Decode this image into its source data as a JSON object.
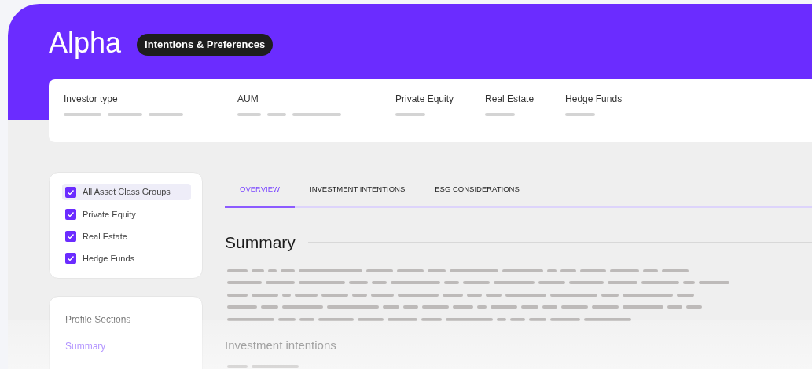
{
  "header": {
    "title": "Alpha",
    "badge": "Intentions & Preferences"
  },
  "info_groups": [
    [
      {
        "label": "Investor type"
      }
    ],
    [
      {
        "label": "AUM"
      }
    ],
    [
      {
        "label": "Private Equity"
      },
      {
        "label": "Real Estate"
      },
      {
        "label": "Hedge Funds"
      }
    ]
  ],
  "filters": [
    {
      "label": "All Asset Class Groups",
      "checked": true,
      "selected": true
    },
    {
      "label": "Private Equity",
      "checked": true,
      "selected": false
    },
    {
      "label": "Real Estate",
      "checked": true,
      "selected": false
    },
    {
      "label": "Hedge Funds",
      "checked": true,
      "selected": false
    }
  ],
  "profile_sections": {
    "title": "Profile Sections",
    "items": [
      {
        "label": "Summary",
        "selected": true
      }
    ]
  },
  "tabs": [
    {
      "label": "OVERVIEW",
      "selected": true
    },
    {
      "label": "INVESTMENT INTENTIONS",
      "selected": false
    },
    {
      "label": "ESG CONSIDERATIONS",
      "selected": false
    }
  ],
  "sections": [
    {
      "title": "Summary"
    },
    {
      "title": "Investment intentions"
    }
  ]
}
